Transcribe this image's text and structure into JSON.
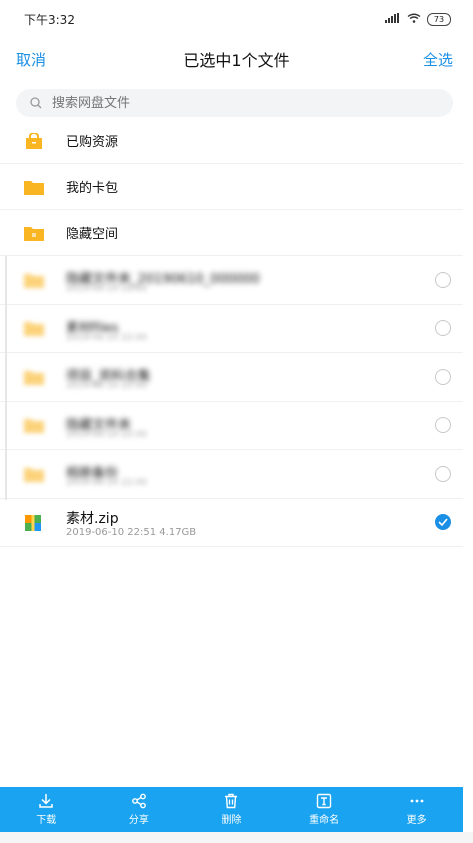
{
  "status": {
    "time": "下午3:32",
    "battery": "73"
  },
  "header": {
    "cancel": "取消",
    "title": "已选中1个文件",
    "select_all": "全选"
  },
  "search": {
    "placeholder": "搜索网盘文件"
  },
  "folders": [
    {
      "label": "已购资源",
      "icon": "shopping-folder-icon"
    },
    {
      "label": "我的卡包",
      "icon": "folder-icon"
    },
    {
      "label": "隐藏空间",
      "icon": "lock-folder-icon"
    }
  ],
  "blurred_files": [
    {
      "label": "隐藏文件夹_20190610_000000",
      "meta": "2019-06-10 22:00"
    },
    {
      "label": "素材files",
      "meta": "2019-06-10 22:00"
    },
    {
      "label": "项目_资料合集",
      "meta": "2019-06-10 22:00"
    },
    {
      "label": "隐藏文件夹",
      "meta": "2019-06-10 22:00"
    },
    {
      "label": "相册备份",
      "meta": "2019-06-10 22:00"
    }
  ],
  "selected_file": {
    "name": "素材.zip",
    "meta": "2019-06-10  22:51   4.17GB",
    "icon": "zip-archive-icon"
  },
  "toolbar": [
    {
      "label": "下载",
      "icon": "download-icon"
    },
    {
      "label": "分享",
      "icon": "share-icon"
    },
    {
      "label": "删除",
      "icon": "trash-icon"
    },
    {
      "label": "重命名",
      "icon": "rename-icon"
    },
    {
      "label": "更多",
      "icon": "more-icon"
    }
  ],
  "colors": {
    "accent": "#1a8fe6",
    "toolbar": "#1aa3f0",
    "folder": "#f9b522"
  }
}
